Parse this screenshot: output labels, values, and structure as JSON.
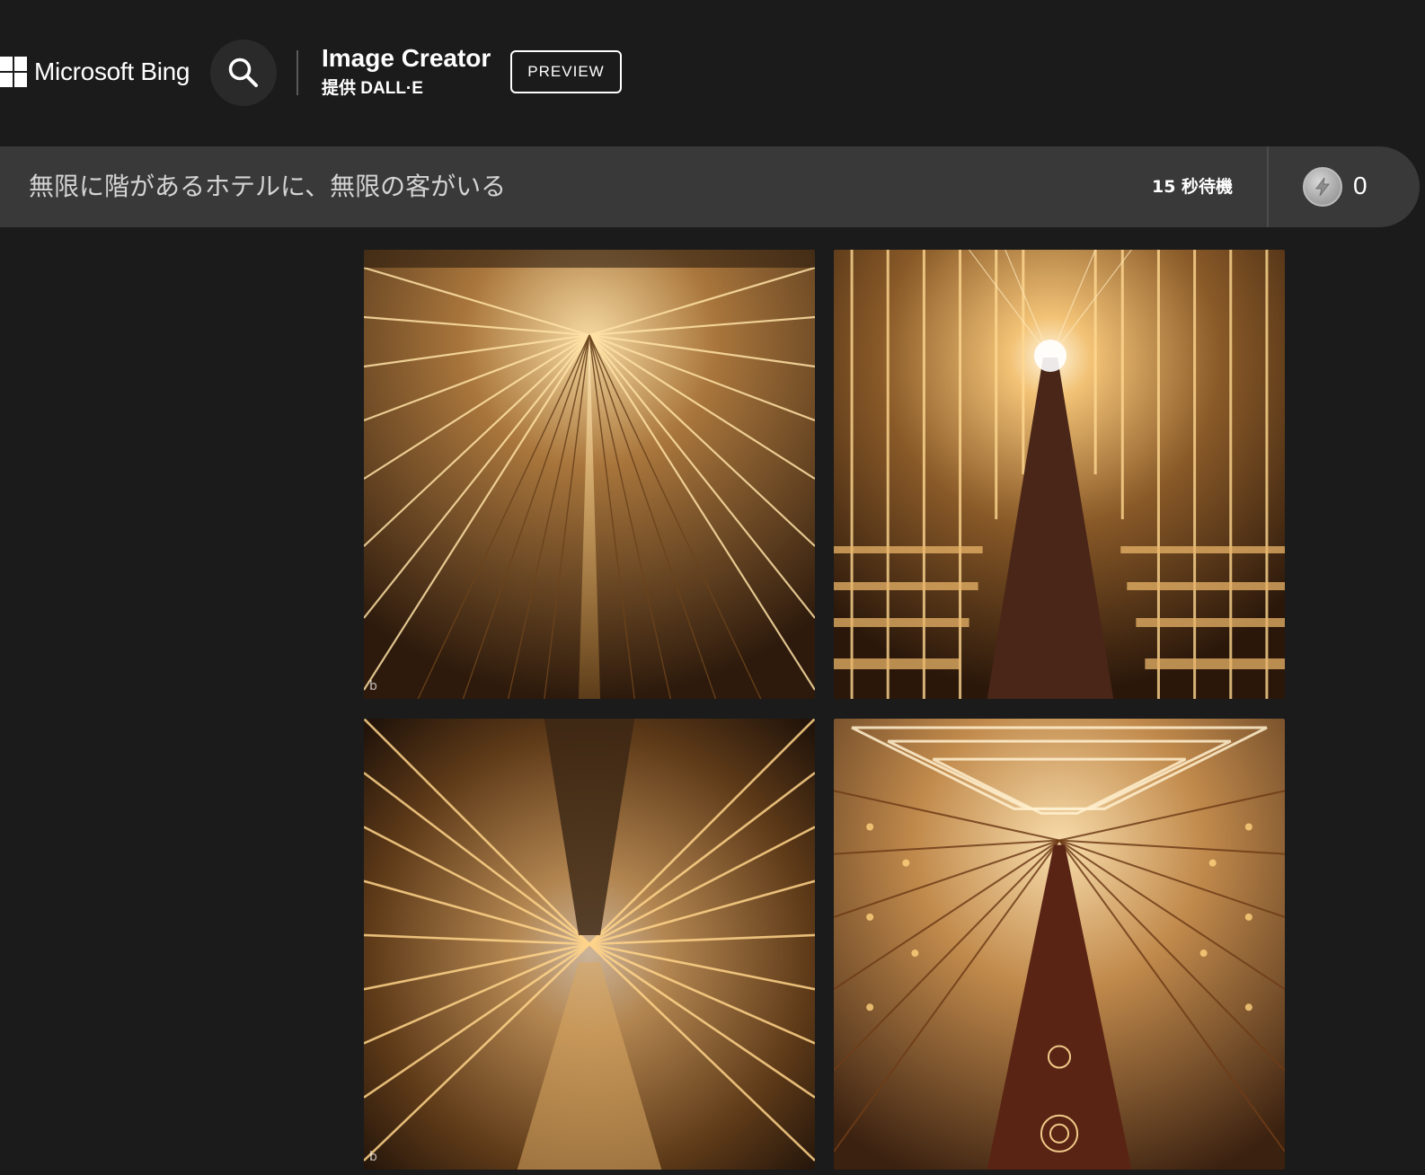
{
  "header": {
    "brand": "Microsoft Bing",
    "app_title": "Image Creator",
    "app_subtitle": "提供 DALL·E",
    "badge": "PREVIEW",
    "icons": {
      "logo": "windows-logo-icon",
      "search": "search-icon"
    }
  },
  "prompt": {
    "text": "無限に階があるホテルに、無限の客がいる",
    "wait_label": "15 秒待機",
    "boost_count": "0",
    "boost_icon": "lightning-coin-icon"
  },
  "results": {
    "images": [
      {
        "name": "generated-image-1",
        "watermark": "b"
      },
      {
        "name": "generated-image-2",
        "watermark": ""
      },
      {
        "name": "generated-image-3",
        "watermark": "b"
      },
      {
        "name": "generated-image-4",
        "watermark": ""
      }
    ]
  },
  "colors": {
    "background": "#1b1b1b",
    "prompt_bar": "#393939",
    "gold_light": "#f3c77a",
    "gold_dark": "#3a2412"
  }
}
